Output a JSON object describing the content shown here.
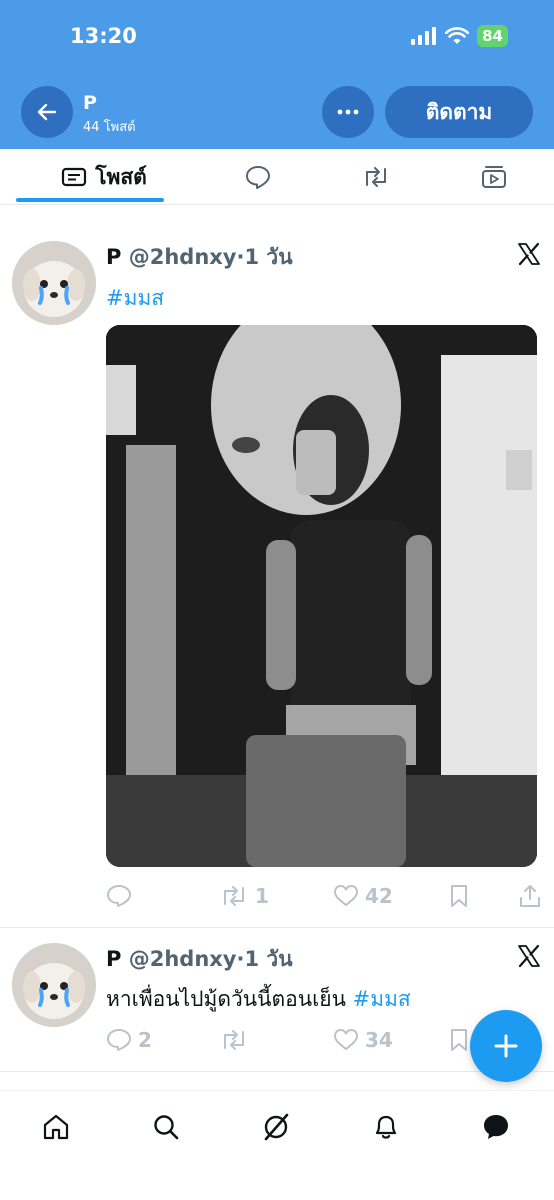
{
  "status_bar": {
    "time": "13:20",
    "battery": "84"
  },
  "header": {
    "name": "P",
    "post_count": "44 โพสต์",
    "follow_label": "ติดตาม"
  },
  "tabs": {
    "posts_label": "โพสต์"
  },
  "posts": [
    {
      "name": "P",
      "handle": "@2hdnxy",
      "time": "·1 วัน",
      "text": "",
      "hashtag": "#มมส",
      "retweets": "1",
      "likes": "42",
      "image_description": "grayscale mirror selfie photo"
    },
    {
      "name": "P",
      "handle": "@2hdnxy",
      "time": "·1 วัน",
      "text": "หาเพื่อนไปมู้ดวันนี้ตอนเย็น ",
      "hashtag": "#มมส",
      "replies": "2",
      "likes": "34"
    }
  ],
  "colors": {
    "header_bg": "#4c9be8",
    "accent": "#1d9bf0",
    "header_button": "#2f6fc0"
  }
}
